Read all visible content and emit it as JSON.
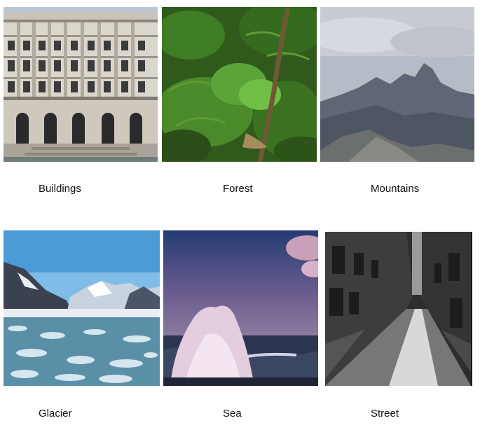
{
  "grid": {
    "items": [
      {
        "label": "Buildings",
        "image": "building-facade-photo"
      },
      {
        "label": "Forest",
        "image": "forest-ferns-photo"
      },
      {
        "label": "Mountains",
        "image": "mountain-range-photo"
      },
      {
        "label": "Glacier",
        "image": "glacier-ice-photo"
      },
      {
        "label": "Sea",
        "image": "sea-wave-splash-photo"
      },
      {
        "label": "Street",
        "image": "rainy-alley-street-photo"
      }
    ]
  }
}
